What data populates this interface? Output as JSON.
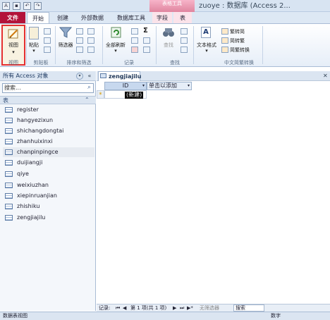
{
  "window": {
    "contextual_tab_group": "表格工具",
    "title": "zuoye : 数据库 (Access 2..."
  },
  "ribbon": {
    "tabs": [
      "文件",
      "开始",
      "创建",
      "外部数据",
      "数据库工具",
      "字段",
      "表"
    ],
    "groups": [
      "视图",
      "剪贴板",
      "排序和筛选",
      "记录",
      "查找",
      "中文简繁转换"
    ],
    "buttons": {
      "view": "视图",
      "paste": "粘贴",
      "filter": "筛选器",
      "refresh_all": "全部刷新",
      "find": "查找",
      "text_format": "文本格式",
      "simp_to_trad": "繁转简",
      "trad_to_simp": "简转繁",
      "simp_trad_convert": "简繁转换"
    }
  },
  "nav": {
    "title": "所有 Access 对象",
    "search_placeholder": "搜索...",
    "group": "表",
    "items": [
      "register",
      "hangyezixun",
      "shichangdongtai",
      "zhanhuixinxi",
      "chanpinpingce",
      "duijiangji",
      "qiye",
      "weixiuzhan",
      "xiepinruanjian",
      "zhishiku",
      "zengjiajilu"
    ]
  },
  "document": {
    "tab": "zengjiajilu",
    "columns": [
      "ID",
      "单击以添加"
    ],
    "new_row_marker": "*",
    "new_row_value": "(新建)"
  },
  "record_nav": {
    "label": "记录:",
    "position": "第 1 项(共 1 项)",
    "filter": "无筛选器",
    "search": "搜索"
  },
  "statusbar": {
    "left": "数据表视图",
    "right": "数字"
  }
}
